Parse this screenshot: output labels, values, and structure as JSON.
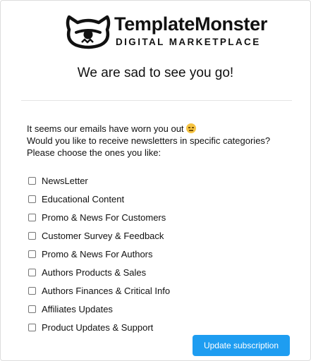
{
  "brand": {
    "name": "TemplateMonster",
    "tagline": "DIGITAL MARKETPLACE",
    "logo_icon": "monster-logo-icon"
  },
  "headline": "We are sad to see you go!",
  "intro": {
    "line1": "It seems our emails have worn you out",
    "line1_emoji": "pensive-face-emoji",
    "line2": "Would you like to receive newsletters in specific categories?",
    "line3": "Please choose the ones you like:"
  },
  "options": [
    {
      "label": "NewsLetter",
      "checked": false
    },
    {
      "label": "Educational Content",
      "checked": false
    },
    {
      "label": "Promo & News For Customers",
      "checked": false
    },
    {
      "label": "Customer Survey & Feedback",
      "checked": false
    },
    {
      "label": "Promo & News For Authors",
      "checked": false
    },
    {
      "label": "Authors Products & Sales",
      "checked": false
    },
    {
      "label": "Authors Finances & Critical Info",
      "checked": false
    },
    {
      "label": "Affiliates Updates",
      "checked": false
    },
    {
      "label": "Product Updates & Support",
      "checked": false
    }
  ],
  "update_button": {
    "label": "Update subscription"
  },
  "colors": {
    "accent": "#1e9df1",
    "text": "#111111",
    "divider": "#e4e4e4"
  }
}
